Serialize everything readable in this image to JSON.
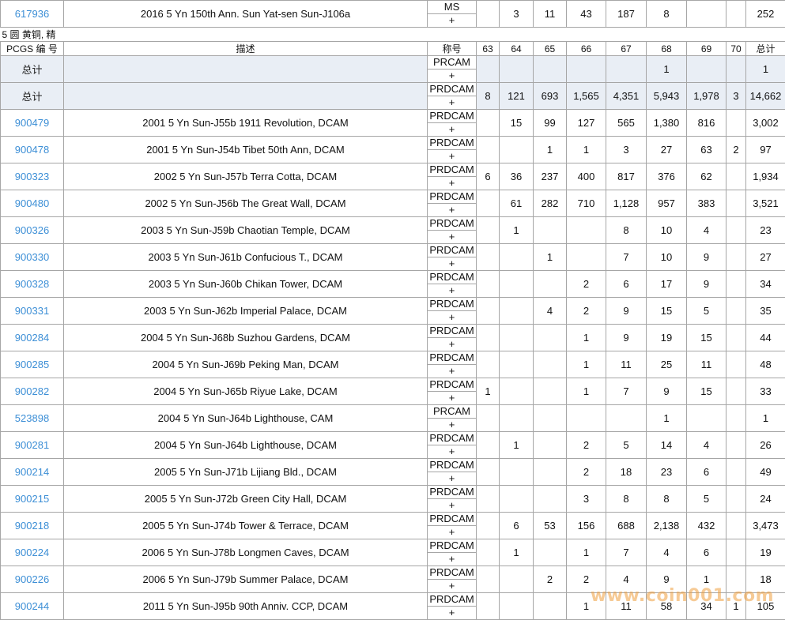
{
  "top_row": {
    "pcgs": "617936",
    "desc": "2016 5 Yn 150th Ann. Sun Yat-sen Sun-J106a",
    "d1": "MS",
    "d2": "+",
    "g63": "",
    "g64": "3",
    "g65": "11",
    "g66": "43",
    "g67": "187",
    "g68": "8",
    "g69": "",
    "g70": "",
    "total": "252"
  },
  "category": "5 圆 黄铜, 精",
  "header": {
    "pcgs": "PCGS 编 号",
    "desc": "描述",
    "designation": "称号",
    "g63": "63",
    "g64": "64",
    "g65": "65",
    "g66": "66",
    "g67": "67",
    "g68": "68",
    "g69": "69",
    "g70": "70",
    "total": "总计"
  },
  "rows": [
    {
      "pcgs": "总计",
      "desc": "",
      "d1": "PRCAM",
      "d2": "+",
      "g63": "",
      "g64": "",
      "g65": "",
      "g66": "",
      "g67": "",
      "g68": "1",
      "g69": "",
      "g70": "",
      "total": "1",
      "kind": "total"
    },
    {
      "pcgs": "总计",
      "desc": "",
      "d1": "PRDCAM",
      "d2": "+",
      "g63": "8",
      "g64": "121",
      "g65": "693",
      "g66": "1,565",
      "g67": "4,351",
      "g68": "5,943",
      "g69": "1,978",
      "g70": "3",
      "total": "14,662",
      "kind": "total"
    },
    {
      "pcgs": "900479",
      "desc": "2001 5 Yn Sun-J55b 1911 Revolution, DCAM",
      "d1": "PRDCAM",
      "d2": "+",
      "g63": "",
      "g64": "15",
      "g65": "99",
      "g66": "127",
      "g67": "565",
      "g68": "1,380",
      "g69": "816",
      "g70": "",
      "total": "3,002"
    },
    {
      "pcgs": "900478",
      "desc": "2001 5 Yn Sun-J54b Tibet 50th Ann, DCAM",
      "d1": "PRDCAM",
      "d2": "+",
      "g63": "",
      "g64": "",
      "g65": "1",
      "g66": "1",
      "g67": "3",
      "g68": "27",
      "g69": "63",
      "g70": "2",
      "total": "97"
    },
    {
      "pcgs": "900323",
      "desc": "2002 5 Yn Sun-J57b Terra Cotta, DCAM",
      "d1": "PRDCAM",
      "d2": "+",
      "g63": "6",
      "g64": "36",
      "g65": "237",
      "g66": "400",
      "g67": "817",
      "g68": "376",
      "g69": "62",
      "g70": "",
      "total": "1,934"
    },
    {
      "pcgs": "900480",
      "desc": "2002 5 Yn Sun-J56b The Great Wall, DCAM",
      "d1": "PRDCAM",
      "d2": "+",
      "g63": "",
      "g64": "61",
      "g65": "282",
      "g66": "710",
      "g67": "1,128",
      "g68": "957",
      "g69": "383",
      "g70": "",
      "total": "3,521"
    },
    {
      "pcgs": "900326",
      "desc": "2003 5 Yn Sun-J59b Chaotian Temple, DCAM",
      "d1": "PRDCAM",
      "d2": "+",
      "g63": "",
      "g64": "1",
      "g65": "",
      "g66": "",
      "g67": "8",
      "g68": "10",
      "g69": "4",
      "g70": "",
      "total": "23"
    },
    {
      "pcgs": "900330",
      "desc": "2003 5 Yn Sun-J61b Confucious T., DCAM",
      "d1": "PRDCAM",
      "d2": "+",
      "g63": "",
      "g64": "",
      "g65": "1",
      "g66": "",
      "g67": "7",
      "g68": "10",
      "g69": "9",
      "g70": "",
      "total": "27"
    },
    {
      "pcgs": "900328",
      "desc": "2003 5 Yn Sun-J60b Chikan Tower, DCAM",
      "d1": "PRDCAM",
      "d2": "+",
      "g63": "",
      "g64": "",
      "g65": "",
      "g66": "2",
      "g67": "6",
      "g68": "17",
      "g69": "9",
      "g70": "",
      "total": "34"
    },
    {
      "pcgs": "900331",
      "desc": "2003 5 Yn Sun-J62b Imperial Palace, DCAM",
      "d1": "PRDCAM",
      "d2": "+",
      "g63": "",
      "g64": "",
      "g65": "4",
      "g66": "2",
      "g67": "9",
      "g68": "15",
      "g69": "5",
      "g70": "",
      "total": "35"
    },
    {
      "pcgs": "900284",
      "desc": "2004 5 Yn Sun-J68b Suzhou Gardens, DCAM",
      "d1": "PRDCAM",
      "d2": "+",
      "g63": "",
      "g64": "",
      "g65": "",
      "g66": "1",
      "g67": "9",
      "g68": "19",
      "g69": "15",
      "g70": "",
      "total": "44"
    },
    {
      "pcgs": "900285",
      "desc": "2004 5 Yn Sun-J69b Peking Man, DCAM",
      "d1": "PRDCAM",
      "d2": "+",
      "g63": "",
      "g64": "",
      "g65": "",
      "g66": "1",
      "g67": "11",
      "g68": "25",
      "g69": "11",
      "g70": "",
      "total": "48"
    },
    {
      "pcgs": "900282",
      "desc": "2004 5 Yn Sun-J65b Riyue Lake, DCAM",
      "d1": "PRDCAM",
      "d2": "+",
      "g63": "1",
      "g64": "",
      "g65": "",
      "g66": "1",
      "g67": "7",
      "g68": "9",
      "g69": "15",
      "g70": "",
      "total": "33"
    },
    {
      "pcgs": "523898",
      "desc": "2004 5 Yn Sun-J64b Lighthouse, CAM",
      "d1": "PRCAM",
      "d2": "+",
      "g63": "",
      "g64": "",
      "g65": "",
      "g66": "",
      "g67": "",
      "g68": "1",
      "g69": "",
      "g70": "",
      "total": "1"
    },
    {
      "pcgs": "900281",
      "desc": "2004 5 Yn Sun-J64b Lighthouse, DCAM",
      "d1": "PRDCAM",
      "d2": "+",
      "g63": "",
      "g64": "1",
      "g65": "",
      "g66": "2",
      "g67": "5",
      "g68": "14",
      "g69": "4",
      "g70": "",
      "total": "26"
    },
    {
      "pcgs": "900214",
      "desc": "2005 5 Yn Sun-J71b Lijiang Bld., DCAM",
      "d1": "PRDCAM",
      "d2": "+",
      "g63": "",
      "g64": "",
      "g65": "",
      "g66": "2",
      "g67": "18",
      "g68": "23",
      "g69": "6",
      "g70": "",
      "total": "49"
    },
    {
      "pcgs": "900215",
      "desc": "2005 5 Yn Sun-J72b Green City Hall, DCAM",
      "d1": "PRDCAM",
      "d2": "+",
      "g63": "",
      "g64": "",
      "g65": "",
      "g66": "3",
      "g67": "8",
      "g68": "8",
      "g69": "5",
      "g70": "",
      "total": "24"
    },
    {
      "pcgs": "900218",
      "desc": "2005 5 Yn Sun-J74b Tower & Terrace, DCAM",
      "d1": "PRDCAM",
      "d2": "+",
      "g63": "",
      "g64": "6",
      "g65": "53",
      "g66": "156",
      "g67": "688",
      "g68": "2,138",
      "g69": "432",
      "g70": "",
      "total": "3,473"
    },
    {
      "pcgs": "900224",
      "desc": "2006 5 Yn Sun-J78b Longmen Caves, DCAM",
      "d1": "PRDCAM",
      "d2": "+",
      "g63": "",
      "g64": "1",
      "g65": "",
      "g66": "1",
      "g67": "7",
      "g68": "4",
      "g69": "6",
      "g70": "",
      "total": "19"
    },
    {
      "pcgs": "900226",
      "desc": "2006 5 Yn Sun-J79b Summer Palace, DCAM",
      "d1": "PRDCAM",
      "d2": "+",
      "g63": "",
      "g64": "",
      "g65": "2",
      "g66": "2",
      "g67": "4",
      "g68": "9",
      "g69": "1",
      "g70": "",
      "total": "18"
    },
    {
      "pcgs": "900244",
      "desc": "2011 5 Yn Sun-J95b 90th Anniv. CCP, DCAM",
      "d1": "PRDCAM",
      "d2": "+",
      "g63": "",
      "g64": "",
      "g65": "",
      "g66": "1",
      "g67": "11",
      "g68": "58",
      "g69": "34",
      "g70": "1",
      "total": "105"
    }
  ],
  "watermark": "www.coin001.com"
}
